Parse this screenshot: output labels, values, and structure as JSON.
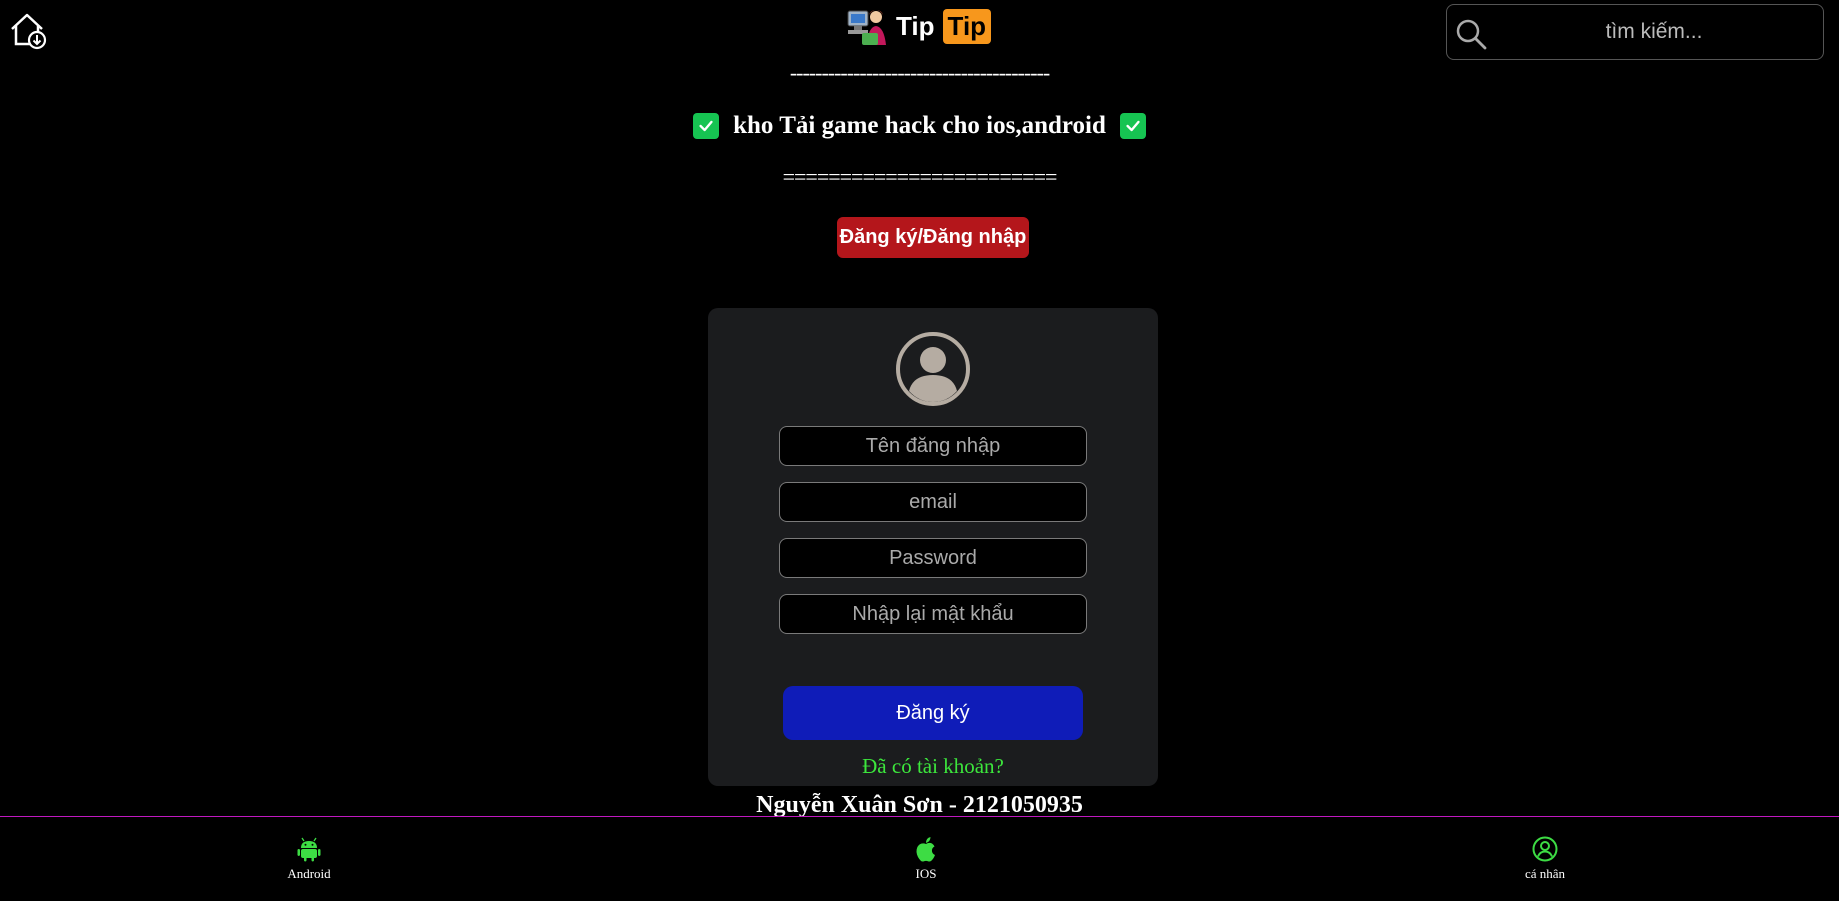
{
  "header": {
    "logo_text_1": "Tip",
    "logo_text_2": "Tip",
    "search_placeholder": "tìm kiếm..."
  },
  "hero": {
    "dash_top": "-----------------------------------------",
    "headline": "kho Tải game hack cho ios,android",
    "dash_bottom": "========================",
    "auth_button": "Đăng ký/Đăng nhập"
  },
  "form": {
    "username_placeholder": "Tên đăng nhập",
    "email_placeholder": "email",
    "password_placeholder": "Password",
    "confirm_placeholder": "Nhập lại mật khẩu",
    "submit_label": "Đăng ký",
    "login_link": "Đã có tài khoản?"
  },
  "footer": {
    "author": "Nguyễn Xuân Sơn - 2121050935"
  },
  "bottom_nav": {
    "items": [
      {
        "label": "Android",
        "icon": "android-icon"
      },
      {
        "label": "IOS",
        "icon": "apple-icon"
      },
      {
        "label": "cá nhân",
        "icon": "user-circle-icon"
      }
    ]
  },
  "colors": {
    "accent_red": "#b4161b",
    "accent_blue": "#0f1cb8",
    "accent_green": "#3ce63c",
    "logo_orange": "#f7971c",
    "nav_border": "#c018c0"
  }
}
